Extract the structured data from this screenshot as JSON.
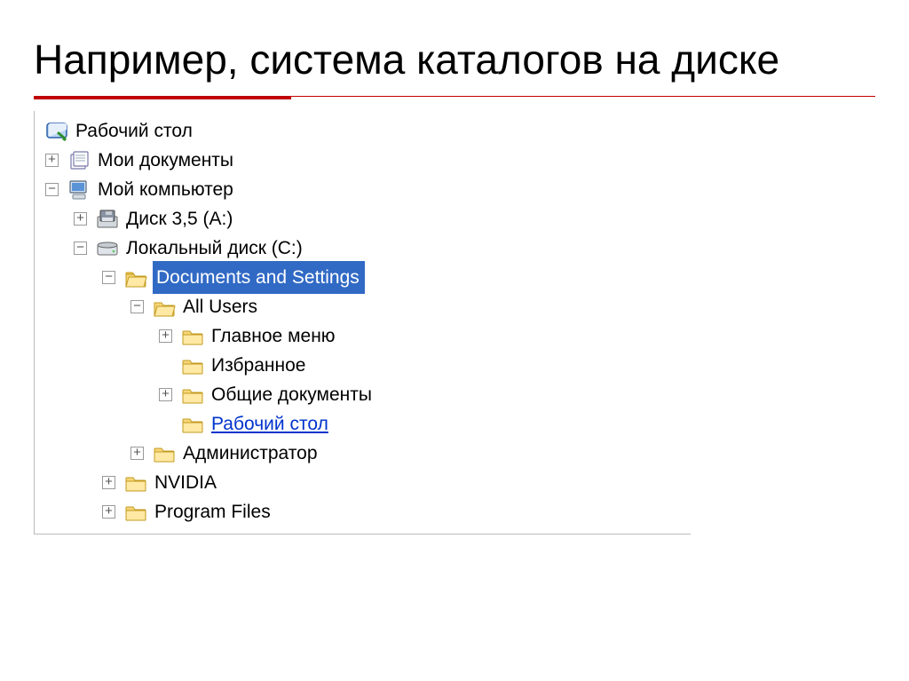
{
  "title": "Например, система каталогов на диске",
  "tree": {
    "desktop": "Рабочий стол",
    "mydocs": "Мои документы",
    "mycomp": "Мой компьютер",
    "floppy": "Диск 3,5 (A:)",
    "localc": "Локальный диск (C:)",
    "docset": "Documents and Settings",
    "allusers": "All Users",
    "startmenu": "Главное меню",
    "favorites": "Избранное",
    "shared": "Общие документы",
    "udesktop": "Рабочий стол",
    "admin": "Администратор",
    "nvidia": "NVIDIA",
    "progfiles": "Program Files"
  },
  "glyph": {
    "plus": "+",
    "minus": "−"
  }
}
